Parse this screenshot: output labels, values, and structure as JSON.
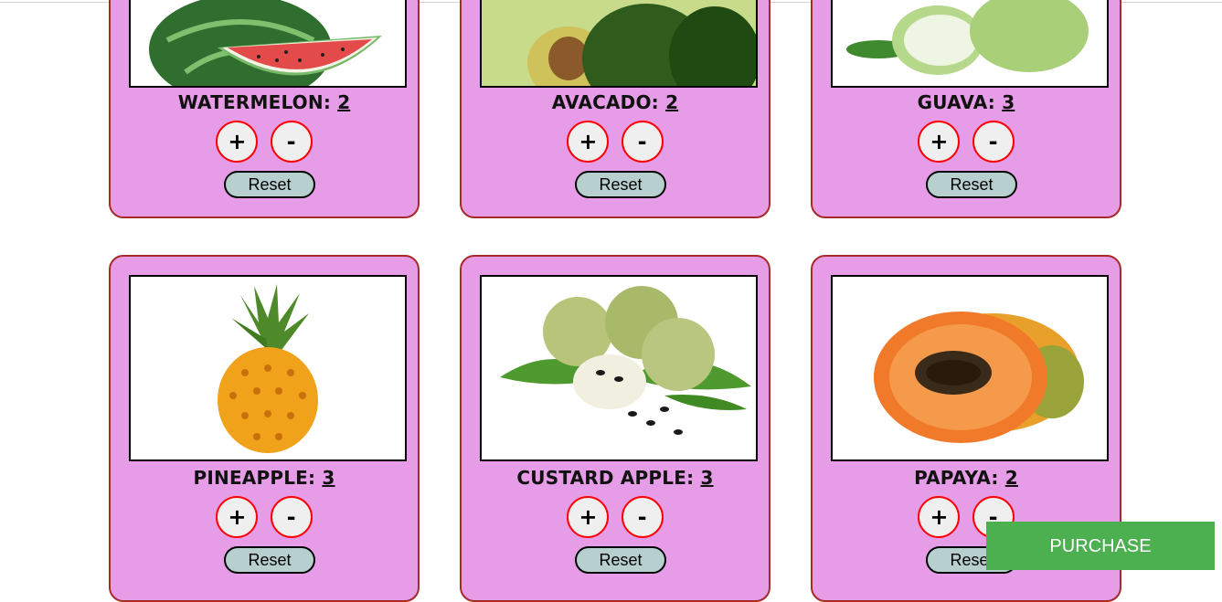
{
  "cards": [
    {
      "name": "WATERMELON:",
      "count": "2",
      "plus": "+",
      "minus": "-",
      "reset": "Reset"
    },
    {
      "name": "AVACADO:",
      "count": "2",
      "plus": "+",
      "minus": "-",
      "reset": "Reset"
    },
    {
      "name": "GUAVA:",
      "count": "3",
      "plus": "+",
      "minus": "-",
      "reset": "Reset"
    },
    {
      "name": "PINEAPPLE:",
      "count": "3",
      "plus": "+",
      "minus": "-",
      "reset": "Reset"
    },
    {
      "name": "CUSTARD APPLE:",
      "count": "3",
      "plus": "+",
      "minus": "-",
      "reset": "Reset"
    },
    {
      "name": "PAPAYA:",
      "count": "2",
      "plus": "+",
      "minus": "-",
      "reset": "Reset"
    }
  ],
  "purchase_label": "PURCHASE",
  "colors": {
    "card_bg": "#e69ce6",
    "card_border": "#a52a2a",
    "qty_border": "#ff0000",
    "reset_bg": "#b8cfd0",
    "purchase_bg": "#4caf50"
  }
}
